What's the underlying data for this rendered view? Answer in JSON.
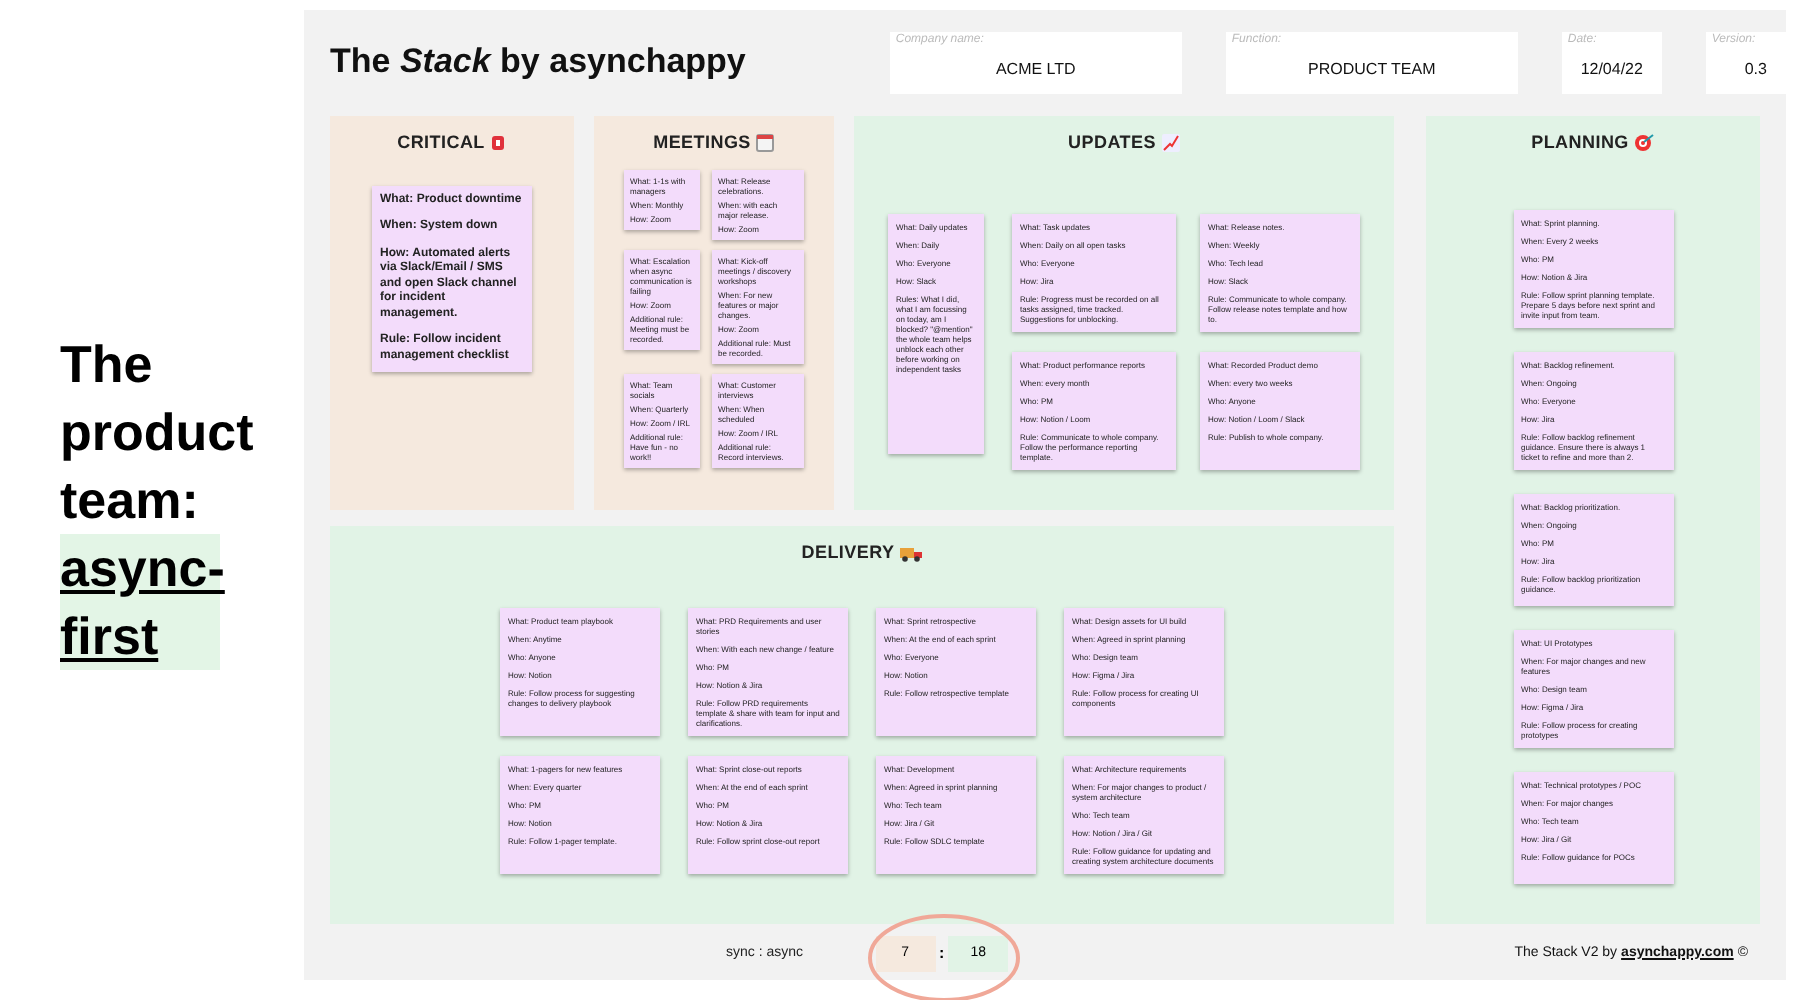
{
  "page_heading": {
    "text": "The product team:",
    "highlight": "async-first"
  },
  "board": {
    "title": "The *Stack* by asynchappy",
    "fields": [
      {
        "label": "Company name:",
        "value": "ACME LTD"
      },
      {
        "label": "Function:",
        "value": "PRODUCT TEAM"
      },
      {
        "label": "Date:",
        "value": "12/04/22"
      },
      {
        "label": "Version:",
        "value": "0.3"
      }
    ],
    "sections": [
      {
        "title": "CRITICAL",
        "kind": "critical",
        "color": "#f5e9de",
        "notes": [
          [
            "What: Product downtime",
            "When: System down",
            "How: Automated alerts via Slack/Email / SMS and open Slack channel for incident management.",
            "Rule: Follow incident management checklist"
          ]
        ]
      },
      {
        "title": "MEETINGS",
        "kind": "meetings",
        "color": "#f5e9de",
        "notes": [
          [
            "What: 1-1s with managers",
            "When: Monthly",
            "How: Zoom"
          ],
          [
            "What: Release celebrations.",
            "When: with each major release.",
            "How: Zoom"
          ],
          [
            "What: Escalation when async communication is failing",
            "How: Zoom",
            "Additional rule: Meeting must be recorded."
          ],
          [
            "What: Kick-off meetings / discovery workshops",
            "When: For new features or major changes.",
            "How: Zoom",
            "Additional rule: Must be recorded."
          ],
          [
            "What: Team socials",
            "When: Quarterly",
            "How: Zoom / IRL",
            "Additional rule: Have fun - no work!!"
          ],
          [
            "What: Customer interviews",
            "When: When scheduled",
            "How: Zoom / IRL",
            "Additional rule: Record interviews."
          ]
        ]
      },
      {
        "title": "UPDATES",
        "kind": "updates",
        "color": "#e1f3e6",
        "notes": [
          [
            "What: Daily updates",
            "When: Daily",
            "Who: Everyone",
            "How: Slack",
            "Rules: What I did, what I am focussing on today, am I blocked? \"@mention\" the whole team helps unblock each other before working on independent tasks"
          ],
          [
            "What: Task updates",
            "When: Daily on all open tasks",
            "Who: Everyone",
            "How: Jira",
            "Rule: Progress must be recorded on all tasks assigned, time tracked. Suggestions for unblocking."
          ],
          [
            "What: Release notes.",
            "When: Weekly",
            "Who: Tech lead",
            "How: Slack",
            "Rule: Communicate to whole company. Follow release notes template and how to."
          ],
          [
            "What: Product performance reports",
            "When: every month",
            "Who: PM",
            "How: Notion / Loom",
            "Rule: Communicate to whole company. Follow the performance reporting template."
          ],
          [
            "What: Recorded Product demo",
            "When: every two weeks",
            "Who: Anyone",
            "How: Notion / Loom / Slack",
            "Rule: Publish to whole company."
          ]
        ]
      },
      {
        "title": "PLANNING",
        "kind": "planning",
        "color": "#e1f3e6",
        "notes": [
          [
            "What: Sprint planning.",
            "When: Every 2 weeks",
            "Who: PM",
            "How: Notion & Jira",
            "Rule: Follow sprint planning template. Prepare 5 days before next sprint and invite input from team."
          ],
          [
            "What: Backlog refinement.",
            "When: Ongoing",
            "Who: Everyone",
            "How: Jira",
            "Rule: Follow backlog refinement guidance. Ensure there is always 1 ticket to refine and more than 2."
          ],
          [
            "What: Backlog prioritization.",
            "When: Ongoing",
            "Who: PM",
            "How: Jira",
            "Rule: Follow backlog prioritization guidance."
          ],
          [
            "What: UI Prototypes",
            "When: For major changes and new features",
            "Who: Design team",
            "How: Figma / Jira",
            "Rule: Follow process for creating prototypes"
          ],
          [
            "What: Technical prototypes / POC",
            "When: For major changes",
            "Who: Tech team",
            "How: Jira / Git",
            "Rule: Follow guidance for POCs"
          ]
        ]
      },
      {
        "title": "DELIVERY",
        "kind": "delivery",
        "color": "#e1f3e6",
        "notes": [
          [
            "What: Product team playbook",
            "When: Anytime",
            "Who: Anyone",
            "How: Notion",
            "Rule: Follow process for suggesting changes to delivery playbook"
          ],
          [
            "What: PRD Requirements and user stories",
            "When: With each new change / feature",
            "Who: PM",
            "How: Notion & Jira",
            "Rule: Follow PRD requirements template & share with team for input and clarifications."
          ],
          [
            "What: Sprint retrospective",
            "When: At the end of each sprint",
            "Who: Everyone",
            "How: Notion",
            "Rule: Follow retrospective template"
          ],
          [
            "What: Design assets for UI build",
            "When: Agreed in sprint planning",
            "Who: Design team",
            "How: Figma / Jira",
            "Rule: Follow process for creating UI components"
          ],
          [
            "What: 1-pagers for new features",
            "When: Every quarter",
            "Who: PM",
            "How: Notion",
            "Rule: Follow 1-pager template."
          ],
          [
            "What: Sprint close-out reports",
            "When: At the end of each sprint",
            "Who: PM",
            "How: Notion & Jira",
            "Rule: Follow sprint close-out report"
          ],
          [
            "What: Development",
            "When: Agreed in sprint planning",
            "Who: Tech team",
            "How: Jira / Git",
            "Rule: Follow SDLC template"
          ],
          [
            "What: Architecture requirements",
            "When: For major changes to product / system architecture",
            "Who: Tech team",
            "How: Notion / Jira / Git",
            "Rule: Follow guidance for updating and creating system architecture documents"
          ]
        ]
      }
    ]
  },
  "footer": {
    "ratio_label": "sync : async",
    "sync": "7",
    "separator": ":",
    "async": "18",
    "credit_text": "The Stack V2 by",
    "credit_link": "asynchappy.com",
    "credit_suffix": "©"
  }
}
